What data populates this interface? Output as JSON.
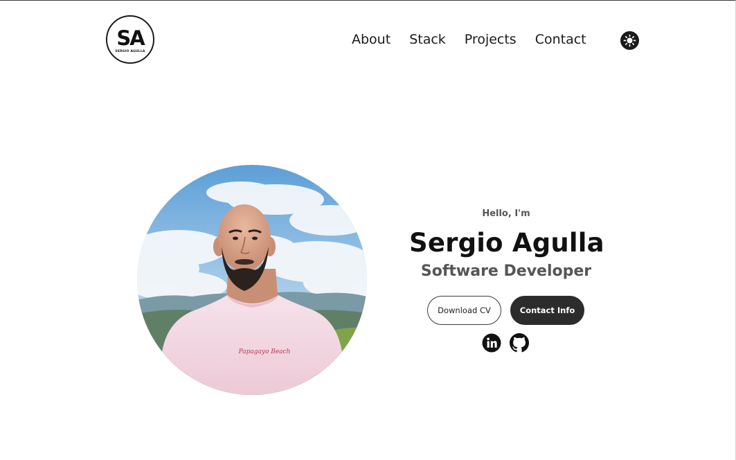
{
  "header": {
    "logo": {
      "initials": "SA",
      "name": "SERGIO AGULLA"
    },
    "nav": [
      {
        "label": "About"
      },
      {
        "label": "Stack"
      },
      {
        "label": "Projects"
      },
      {
        "label": "Contact"
      }
    ],
    "theme_toggle_icon": "sun-icon"
  },
  "hero": {
    "greeting": "Hello, I'm",
    "name": "Sergio Agulla",
    "role": "Software Developer",
    "photo_alt": "Sergio Agulla profile photo",
    "shirt_text": "Papagayo Beach",
    "buttons": {
      "download_cv": "Download CV",
      "contact_info": "Contact Info"
    },
    "social": [
      {
        "icon": "linkedin-icon"
      },
      {
        "icon": "github-icon"
      }
    ]
  },
  "colors": {
    "primary_text": "#111111",
    "secondary_text": "#555555",
    "button_dark": "#2c2c2c",
    "background": "#ffffff"
  }
}
